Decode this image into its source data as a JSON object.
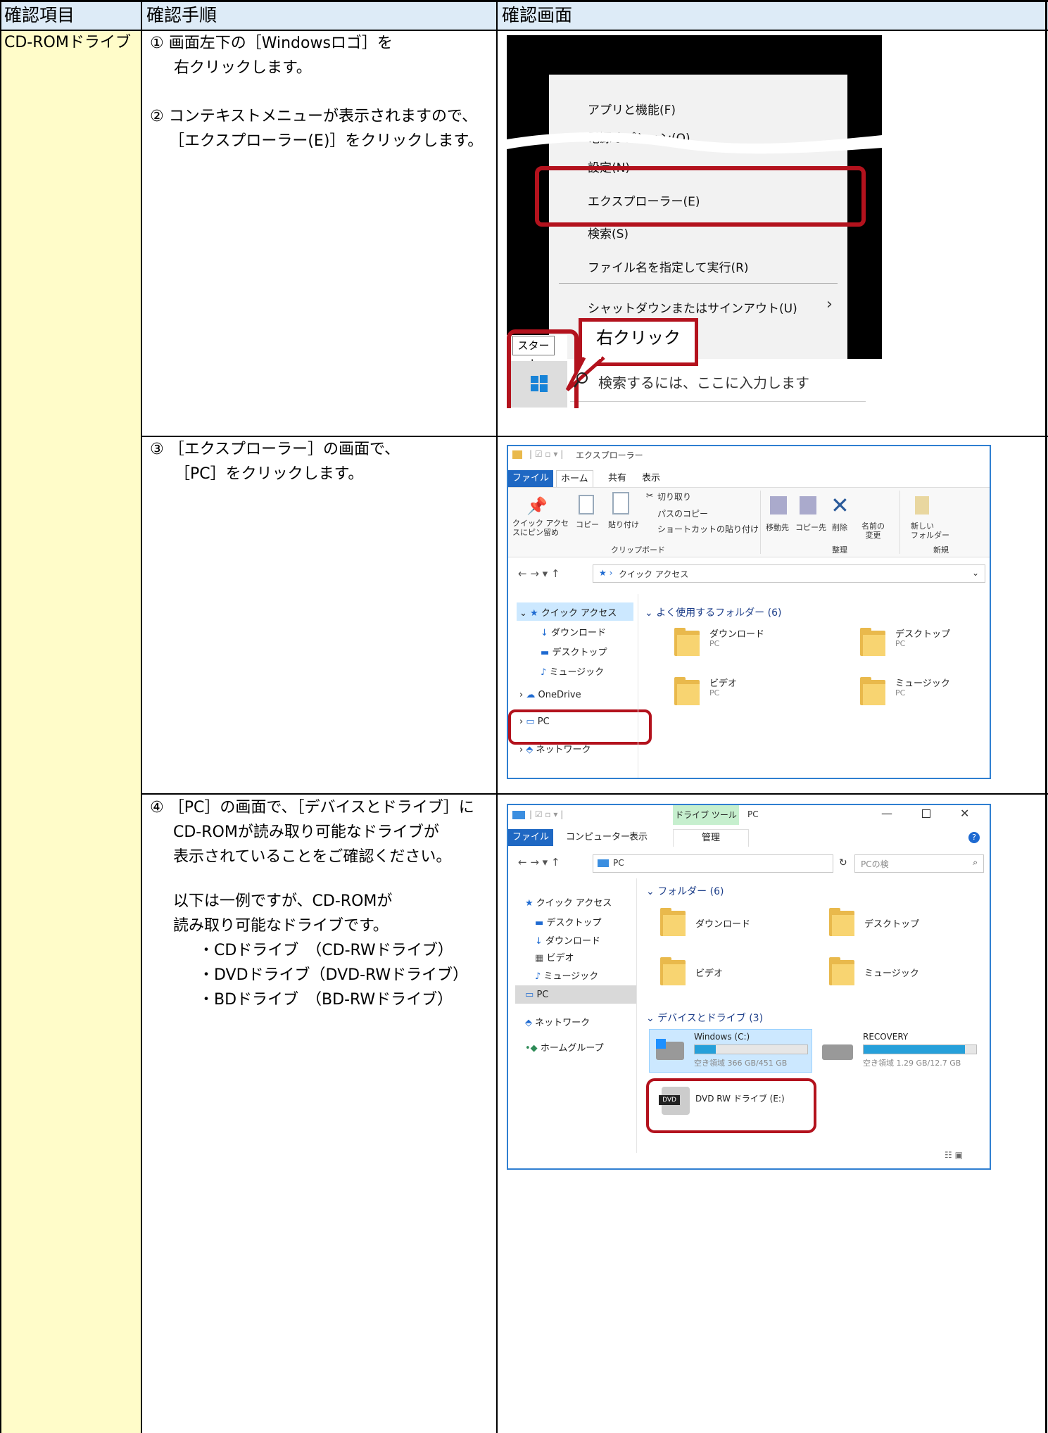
{
  "header": {
    "col1": "確認項目",
    "col2": "確認手順",
    "col3": "確認画面"
  },
  "item": "CD-ROMドライブ",
  "steps": {
    "s1_line1": "① 画面左下の［Windowsロゴ］を",
    "s1_line2": "右クリックします。",
    "s2_line1": "② コンテキストメニューが表示されますので、",
    "s2_line2": "［エクスプローラー(E)］をクリックします。",
    "s3_line1": "③ ［エクスプローラー］の画面で、",
    "s3_line2": "［PC］をクリックします。",
    "s4_line1": "④ ［PC］の画面で、［デバイスとドライブ］に",
    "s4_line2": "CD-ROMが読み取り可能なドライブが",
    "s4_line3": "表示されていることをご確認ください。",
    "s4_line4": "以下は一例ですが、CD-ROMが",
    "s4_line5": "読み取り可能なドライブです。",
    "s4_line6": "・CDドライブ　（CD-RWドライブ）",
    "s4_line7": "・DVDドライブ（DVD-RWドライブ）",
    "s4_line8": "・BDドライブ　（BD-RWドライブ）"
  },
  "screen1": {
    "menu_items": [
      "アプリと機能(F)",
      "電源オプション(O)",
      "設定(N)",
      "エクスプローラー(E)",
      "検索(S)",
      "ファイル名を指定して実行(R)",
      "シャットダウンまたはサインアウト(U)"
    ],
    "callout": "右クリック",
    "tooltip": "スタート",
    "search_placeholder": "検索するには、ここに入力します"
  },
  "screen2": {
    "title": "エクスプローラー",
    "tabs": [
      "ファイル",
      "ホーム",
      "共有",
      "表示"
    ],
    "ribbon": {
      "pin": "クイック アクセ\nスにピン留め",
      "copy": "コピー",
      "paste": "貼り付け",
      "cut": "切り取り",
      "copy_path": "パスのコピー",
      "paste_shortcut": "ショートカットの貼り付け",
      "move_to": "移動先",
      "copy_to": "コピー先",
      "delete": "削除",
      "rename": "名前の\n変更",
      "new_folder": "新しい\nフォルダー",
      "group_clipboard": "クリップボード",
      "group_organize": "整理",
      "group_new": "新規"
    },
    "address": "クイック アクセス",
    "nav": [
      "クイック アクセス",
      "ダウンロード",
      "デスクトップ",
      "ミュージック",
      "OneDrive",
      "PC",
      "ネットワーク"
    ],
    "section": "よく使用するフォルダー (6)",
    "folders": [
      {
        "name": "ダウンロード",
        "sub": "PC"
      },
      {
        "name": "デスクトップ",
        "sub": "PC"
      },
      {
        "name": "ビデオ",
        "sub": "PC"
      },
      {
        "name": "ミュージック",
        "sub": "PC"
      }
    ]
  },
  "screen3": {
    "drive_tools": "ドライブ ツール",
    "title": "PC",
    "tabs": [
      "ファイル",
      "コンピューター",
      "表示",
      "管理"
    ],
    "address": "PC",
    "search_placeholder": "PCの検",
    "nav": [
      "クイック アクセス",
      "デスクトップ",
      "ダウンロード",
      "ビデオ",
      "ミュージック",
      "PC",
      "ネットワーク",
      "ホームグループ"
    ],
    "section_folders": "フォルダー (6)",
    "folders": [
      "ダウンロード",
      "デスクトップ",
      "ビデオ",
      "ミュージック"
    ],
    "section_devices": "デバイスとドライブ (3)",
    "drives": [
      {
        "name": "Windows (C:)",
        "free": "空き領域 366 GB/451 GB",
        "used": 0.19
      },
      {
        "name": "RECOVERY",
        "free": "空き領域 1.29 GB/12.7 GB",
        "used": 0.9
      },
      {
        "name": "DVD RW ドライブ (E:)",
        "free": "",
        "used": 0
      }
    ],
    "dvd_badge": "DVD",
    "colors": {
      "accent": "#1f68c3",
      "drive_tools": "#c6efce",
      "highlight": "#cce8ff",
      "red": "#b3121d"
    }
  }
}
